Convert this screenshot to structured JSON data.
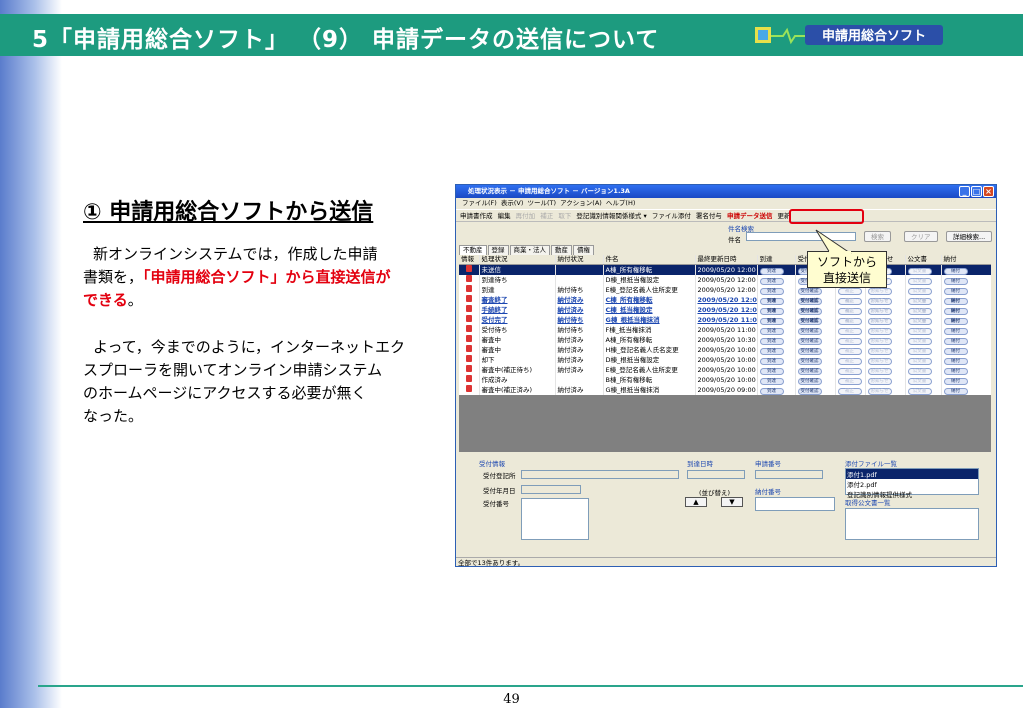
{
  "slide": {
    "title": "5「申請用総合ソフト」 （9） 申請データの送信について",
    "logo_text": "申請用総合ソフト",
    "page_number": "49"
  },
  "section": {
    "heading": "① 申請用総合ソフトから送信",
    "p1_line1": "新オンラインシステムでは，作成した申請",
    "p1_line2_prefix": "書類を，",
    "p1_line2_red": "「申請用総合ソフト」から直接送信が",
    "p1_line3_red": "できる",
    "p1_line3_suffix": "。",
    "p2_line1": "よって，今までのように，インターネットエク",
    "p2_line2": "スプローラを開いてオンライン申請システム",
    "p2_line3": "のホームページにアクセスする必要が無く",
    "p2_line4": "なった。"
  },
  "window": {
    "title": "処理状況表示 － 申請用総合ソフト － バージョン1.3A",
    "menu": [
      "ファイル(F)",
      "表示(V)",
      "ツール(T)",
      "アクション(A)",
      "ヘルプ(H)"
    ],
    "toolbar": [
      "申請書作成",
      "編集",
      "再付加",
      "補正",
      "取下",
      "登記識別情報関係様式 ▾",
      "ファイル添付",
      "署名付与",
      "申請データ送信",
      "更新"
    ],
    "search": {
      "label": "件名検索",
      "field_label": "件名",
      "search_btn": "検索",
      "clear_btn": "クリア",
      "detail_btn": "詳細検索..."
    },
    "tabs": [
      "不動産",
      "登録",
      "商業・法人",
      "動産",
      "債権"
    ],
    "columns": [
      "情報",
      "処理状況",
      "納付状況",
      "件名",
      "最終更新日時",
      "到達",
      "受付",
      "補正",
      "お知らせ",
      "公文書",
      "納付"
    ],
    "rows": [
      {
        "status": "未送信",
        "pay": "",
        "name": "A棟_所有権移転",
        "date": "2009/05/20 12:00",
        "style": "sel"
      },
      {
        "status": "到達待ち",
        "pay": "",
        "name": "D棟_根抵当権設定",
        "date": "2009/05/20 12:00",
        "style": ""
      },
      {
        "status": "到達",
        "pay": "納付待ち",
        "name": "E棟_登記名義人住所変更",
        "date": "2009/05/20 12:00",
        "style": ""
      },
      {
        "status": "審査終了",
        "pay": "納付済み",
        "name": "C棟_所有権移転",
        "date": "2009/05/20 12:00",
        "style": "bold"
      },
      {
        "status": "手続終了",
        "pay": "納付済み",
        "name": "C棟_抵当権設定",
        "date": "2009/05/20 12:00",
        "style": "bold"
      },
      {
        "status": "受付完了",
        "pay": "納付待ち",
        "name": "G棟_根抵当権抹消",
        "date": "2009/05/20 11:00",
        "style": "bold"
      },
      {
        "status": "受付待ち",
        "pay": "納付待ち",
        "name": "F棟_抵当権抹消",
        "date": "2009/05/20 11:00",
        "style": ""
      },
      {
        "status": "審査中",
        "pay": "納付済み",
        "name": "A棟_所有権移転",
        "date": "2009/05/20 10:30",
        "style": ""
      },
      {
        "status": "審査中",
        "pay": "納付済み",
        "name": "H棟_登記名義人氏名変更",
        "date": "2009/05/20 10:00",
        "style": ""
      },
      {
        "status": "却下",
        "pay": "納付済み",
        "name": "D棟_根抵当権設定",
        "date": "2009/05/20 10:00",
        "style": ""
      },
      {
        "status": "審査中(補正待ち)",
        "pay": "納付済み",
        "name": "E棟_登記名義人住所変更",
        "date": "2009/05/20 10:00",
        "style": ""
      },
      {
        "status": "作成済み",
        "pay": "",
        "name": "B棟_所有権移転",
        "date": "2009/05/20 10:00",
        "style": ""
      },
      {
        "status": "審査中(補正済み)",
        "pay": "納付済み",
        "name": "G棟_根抵当権抹消",
        "date": "2009/05/20 09:00",
        "style": ""
      }
    ],
    "row_buttons": [
      "到達",
      "受付確認",
      "補正",
      "お知らせ",
      "公文書",
      "納付"
    ],
    "bottom": {
      "receipt_info": "受付情報",
      "receipt_office": "受付登記所",
      "receipt_date": "受付年月日",
      "receipt_no": "受付番号",
      "arrival_time": "到達日時",
      "app_no": "申請番号",
      "sort": "(並び替え)",
      "pay_no": "納付番号",
      "attach_list": "添付ファイル一覧",
      "attach_files": [
        "添付1.pdf",
        "添付2.pdf",
        "登記識別情報提供様式"
      ],
      "docs_list": "取得公文書一覧"
    },
    "status_bar": "全部で13件あります。"
  },
  "callout": {
    "line1": "ソフトから",
    "line2": "直接送信"
  }
}
